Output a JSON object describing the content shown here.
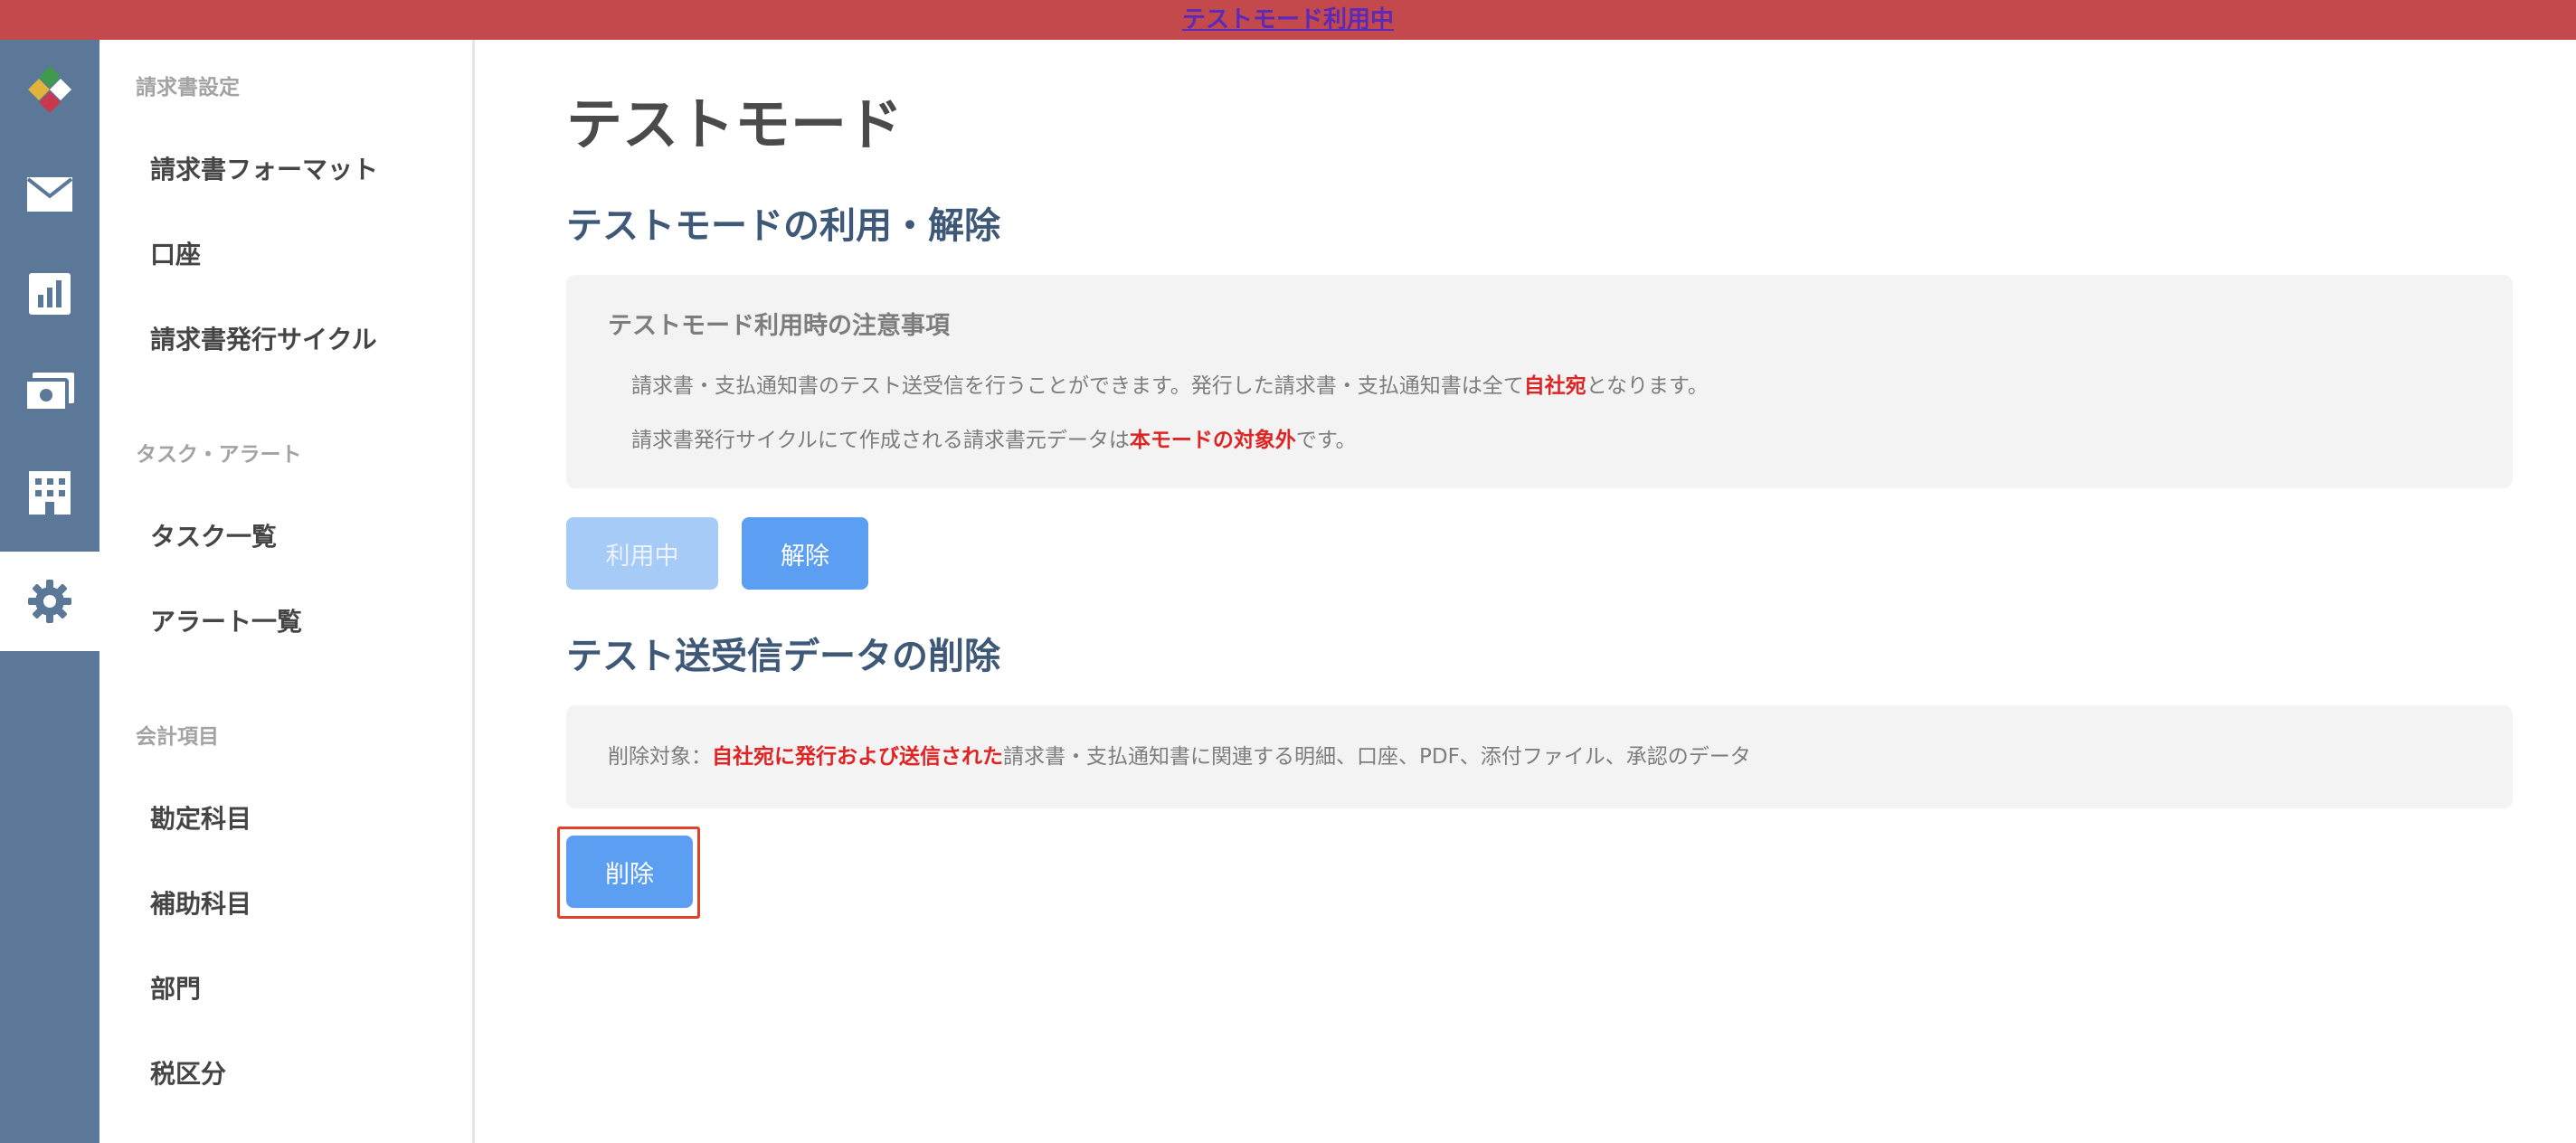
{
  "banner": {
    "text": "テストモード利用中"
  },
  "rail": {
    "items": [
      {
        "icon": "app-logo-icon"
      },
      {
        "icon": "mail-icon"
      },
      {
        "icon": "bar-chart-icon"
      },
      {
        "icon": "payment-icon"
      },
      {
        "icon": "building-icon"
      },
      {
        "icon": "gear-icon",
        "active": true
      }
    ]
  },
  "subnav": {
    "groups": [
      {
        "title": "請求書設定",
        "items": [
          "請求書フォーマット",
          "口座",
          "請求書発行サイクル"
        ]
      },
      {
        "title": "タスク・アラート",
        "items": [
          "タスク一覧",
          "アラート一覧"
        ]
      },
      {
        "title": "会計項目",
        "items": [
          "勘定科目",
          "補助科目",
          "部門",
          "税区分"
        ]
      }
    ]
  },
  "main": {
    "page_title": "テストモード",
    "usage_section": {
      "title": "テストモードの利用・解除",
      "notice_heading": "テストモード利用時の注意事項",
      "line1_before": "請求書・支払通知書のテスト送受信を行うことができます。発行した請求書・支払通知書は全て",
      "line1_emphasis": "自社宛",
      "line1_after": "となります。",
      "line2_before": "請求書発行サイクルにて作成される請求書元データは",
      "line2_emphasis": "本モードの対象外",
      "line2_after": "です。",
      "in_use_button": "利用中",
      "release_button": "解除"
    },
    "delete_section": {
      "title": "テスト送受信データの削除",
      "label": "削除対象：",
      "emphasis": "自社宛に発行および送信された",
      "rest": "請求書・支払通知書に関連する明細、口座、PDF、添付ファイル、承認のデータ",
      "delete_button": "削除"
    }
  },
  "colors": {
    "banner": "#c4494d",
    "rail": "#5b7899",
    "primary_button": "#5b9ef2",
    "disabled_button": "#a7cbf7",
    "emphasis": "#e02424",
    "section_title": "#3e5878"
  }
}
